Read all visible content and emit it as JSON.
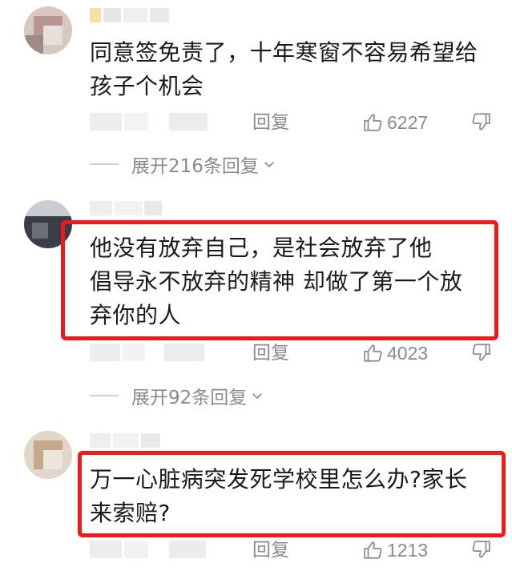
{
  "comments": [
    {
      "text_lines": [
        "同意签免责了，十年寒窗不容易希望给",
        "孩子个机会"
      ],
      "reply_label": "回复",
      "likes": "6227",
      "expand_label": "展开216条回复"
    },
    {
      "text_lines": [
        "他没有放弃自己，是社会放弃了他",
        "倡导永不放弃的精神 却做了第一个放",
        "弃你的人"
      ],
      "reply_label": "回复",
      "likes": "4023",
      "expand_label": "展开92条回复"
    },
    {
      "text_lines": [
        "万一心脏病突发死学校里怎么办?家长",
        "来索赔?"
      ],
      "reply_label": "回复",
      "likes": "1213"
    }
  ],
  "colors": {
    "highlight": "#f01919",
    "meta_text": "#8a8a8a",
    "body_text": "#1a1a1a"
  },
  "icons": [
    "thumbs-up-icon",
    "thumbs-down-icon",
    "chevron-down-icon"
  ]
}
